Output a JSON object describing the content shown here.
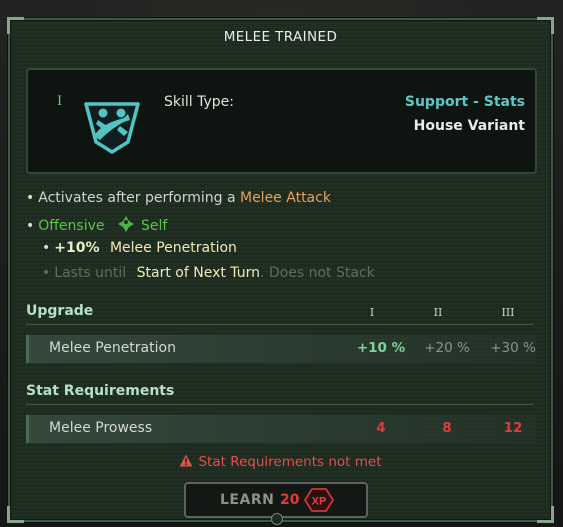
{
  "title": "MELEE TRAINED",
  "skill": {
    "tier_numeral": "I",
    "icon": "melee-skill-icon",
    "type_label": "Skill Type:",
    "type_value": "Support - Stats",
    "variant": "House Variant"
  },
  "description": {
    "line1_prefix": "Activates after performing a",
    "line1_highlight": "Melee Attack",
    "line2_left": "Offensive",
    "line2_icon": "self-target-icon",
    "line2_right": "Self",
    "line3_value": "+10%",
    "line3_text": "Melee Penetration",
    "line4_prefix": "Lasts until",
    "line4_highlight": "Start of Next Turn",
    "line4_suffix": ". Does not Stack"
  },
  "upgrade": {
    "label": "Upgrade",
    "tiers": [
      "I",
      "II",
      "III"
    ],
    "rows": [
      {
        "name": "Melee Penetration",
        "values": [
          "+10 %",
          "+20 %",
          "+30 %"
        ]
      }
    ]
  },
  "requirements": {
    "label": "Stat Requirements",
    "rows": [
      {
        "name": "Melee Prowess",
        "values": [
          "4",
          "8",
          "12"
        ]
      }
    ]
  },
  "warning": "Stat Requirements not met",
  "learn": {
    "label": "LEARN",
    "cost": "20",
    "currency": "XP"
  },
  "colors": {
    "accent_teal": "#5dc8c8",
    "warning_red": "#e2504a",
    "positive_green": "#5fc24e",
    "highlight_orange": "#e6a35a"
  }
}
